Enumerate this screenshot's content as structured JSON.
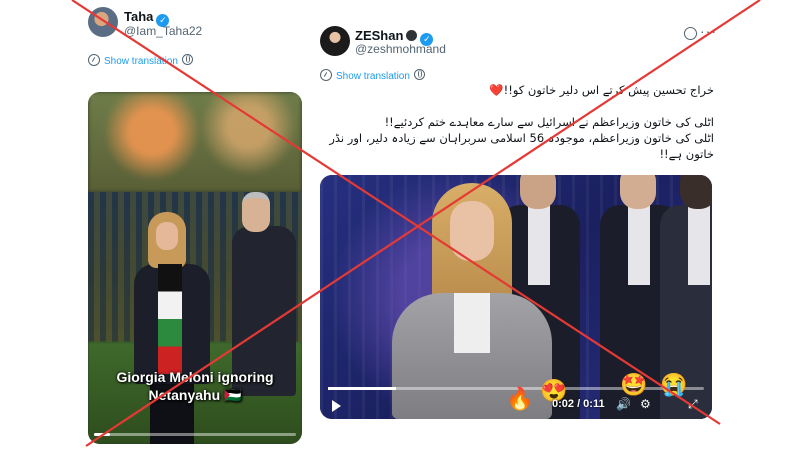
{
  "left_post": {
    "author_name": "Taha",
    "author_handle": "@Iam_Taha22",
    "show_translation": "Show translation",
    "video_caption_line1": "Giorgia Meloni ignoring",
    "video_caption_line2": "Netanyahu 🇵🇸",
    "video_progress": 0.08
  },
  "right_post": {
    "author_name": "ZEShan",
    "author_handle": "@zeshmohmand",
    "show_translation": "Show translation",
    "text_line1": "خراج تحسین پیش کرتے اس دلیر خاتون کو!!",
    "text_line1_heart": "❤️",
    "text_line2": "اٹلی کی خاتون وزیراعظم نے اسرائیل سے سارے معاہدے ختم کردئیے!!",
    "text_line3": "اٹلی کی خاتون وزیراعظم، موجودہ 56 اسلامی سربراہان سے زیادہ دلیر، اور نڈر",
    "text_line4": "خاتون ہے!!",
    "video": {
      "time_readout": "0:02 / 0:11",
      "progress": 0.18,
      "reactions": [
        "🔥",
        "😍",
        "🤩",
        "😭"
      ]
    }
  },
  "icons": [
    "verified-badge-icon",
    "globe-icon",
    "translate-icon",
    "play-icon",
    "volume-icon",
    "settings-icon",
    "fullscreen-icon",
    "more-icon",
    "grok-icon"
  ],
  "colors": {
    "accent": "#1d9bf0",
    "cross": "#e53935",
    "text": "#0f1419",
    "muted": "#536471"
  }
}
